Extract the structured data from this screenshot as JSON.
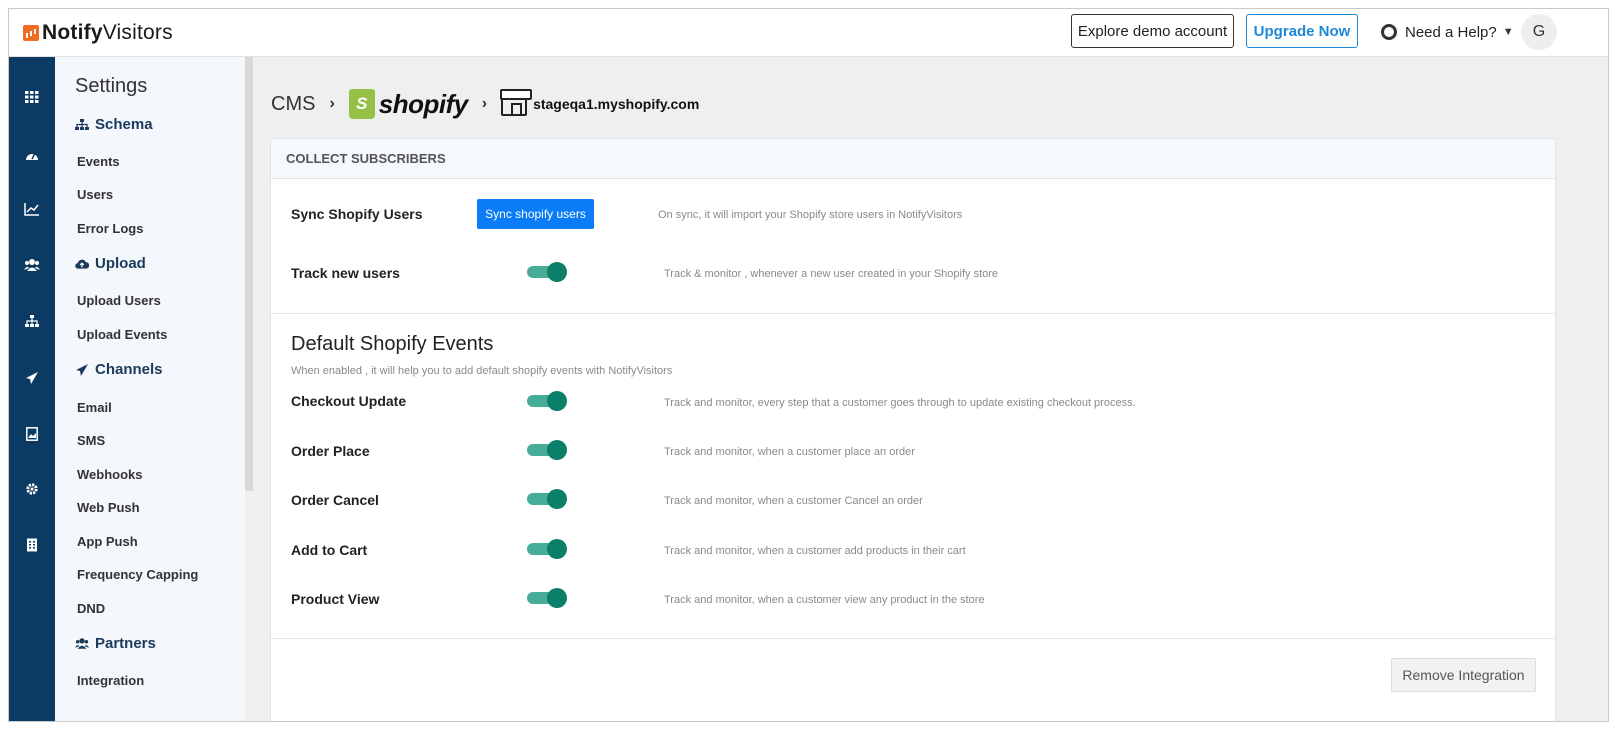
{
  "brand": {
    "name_bold": "Notify",
    "name_regular": "Visitors"
  },
  "topbar": {
    "demo_button": "Explore demo account",
    "upgrade_button": "Upgrade Now",
    "help_label": "Need a Help?",
    "avatar_initial": "G"
  },
  "rail": {
    "icons": [
      "apps-icon",
      "dashboard-icon",
      "analytics-icon",
      "users-icon",
      "hierarchy-icon",
      "send-icon",
      "image-icon",
      "settings-icon",
      "document-icon"
    ]
  },
  "sidebar": {
    "title": "Settings",
    "sections": [
      {
        "heading": "Schema",
        "icon": "sitemap-icon",
        "items": [
          "Events",
          "Users",
          "Error Logs"
        ]
      },
      {
        "heading": "Upload",
        "icon": "cloud-upload-icon",
        "items": [
          "Upload Users",
          "Upload Events"
        ]
      },
      {
        "heading": "Channels",
        "icon": "paper-plane-icon",
        "items": [
          "Email",
          "SMS",
          "Webhooks",
          "Web Push",
          "App Push",
          "Frequency Capping",
          "DND"
        ]
      },
      {
        "heading": "Partners",
        "icon": "users-icon",
        "items": [
          "Integration"
        ]
      }
    ]
  },
  "breadcrumb": {
    "cms": "CMS",
    "platform": "shopify",
    "platform_bag_letter": "S",
    "store": "stageqa1.myshopify.com"
  },
  "collect": {
    "header": "COLLECT SUBSCRIBERS",
    "sync": {
      "label": "Sync Shopify Users",
      "button": "Sync shopify users",
      "desc": "On sync, it will import your Shopify store users in NotifyVisitors"
    },
    "track": {
      "label": "Track new users",
      "enabled": true,
      "desc": "Track & monitor , whenever a new user created in your Shopify store"
    }
  },
  "events": {
    "title": "Default Shopify Events",
    "subtitle": "When enabled , it will help you to add default shopify events with NotifyVisitors",
    "rows": [
      {
        "label": "Checkout Update",
        "enabled": true,
        "desc": "Track and monitor, every step that a customer goes through to update existing checkout process."
      },
      {
        "label": "Order Place",
        "enabled": true,
        "desc": "Track and monitor, when a customer place an order"
      },
      {
        "label": "Order Cancel",
        "enabled": true,
        "desc": "Track and monitor, when a customer Cancel an order"
      },
      {
        "label": "Add to Cart",
        "enabled": true,
        "desc": "Track and monitor, when a customer add products in their cart"
      },
      {
        "label": "Product View",
        "enabled": true,
        "desc": "Track and monitor, when a customer view any product in the store"
      }
    ]
  },
  "footer": {
    "remove_button": "Remove Integration"
  },
  "colors": {
    "rail": "#0b3a63",
    "primary_button": "#0a7cf5",
    "toggle_track": "#46ae98",
    "toggle_knob": "#0b7f69",
    "shopify_green": "#95bf47",
    "brand_orange": "#f26b21"
  }
}
